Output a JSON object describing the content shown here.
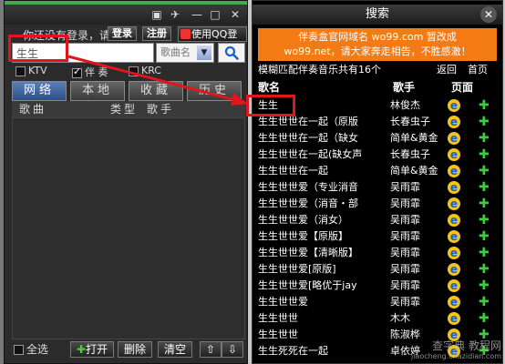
{
  "left_window": {
    "title_buttons": {
      "skin": "▣",
      "pin": "✈",
      "min": "—",
      "max": "□",
      "close": "✕"
    },
    "status_text": "你还没有登录，请",
    "login_label": "登录",
    "register_label": "注册",
    "qq_label": "使用QQ登录",
    "search": {
      "value": "生生",
      "category": "歌曲名",
      "button_icon": "search-icon"
    },
    "checkboxes": [
      {
        "label": "KTV",
        "checked": false
      },
      {
        "label": "伴 奏",
        "checked": true
      },
      {
        "label": "KRC",
        "checked": false
      }
    ],
    "tabs": [
      "网络",
      "本地",
      "收藏",
      "历史"
    ],
    "active_tab": 0,
    "columns": {
      "song": "歌曲",
      "type": "类型",
      "singer": "歌手"
    },
    "bottom": {
      "select_all": "全选",
      "play": "打开",
      "delete": "删除",
      "clear": "清空",
      "up": "⇧",
      "down": "⇩"
    }
  },
  "right_window": {
    "title": "搜索",
    "close_label": "✕",
    "banner_line1": "伴奏盒官网域名 ",
    "banner_url1": "wo99.com",
    "banner_line1_end": " 暂改成",
    "banner_url2": "wo99.net",
    "banner_line2_end": "，请大家奔走相告，不胜感激！",
    "info": "模糊匹配伴奏音乐共有16个",
    "back_label": "返回",
    "home_label": "首页",
    "headers": {
      "song": "歌名",
      "singer": "歌手",
      "page": "页面"
    },
    "rows": [
      {
        "song": "生生",
        "singer": "林俊杰"
      },
      {
        "song": "生生世世在一起（原版",
        "singer": "长春虫子"
      },
      {
        "song": "生生世世在一起（缺女",
        "singer": "简单&黄金"
      },
      {
        "song": "生生世世在一起(缺女声",
        "singer": "长春虫子"
      },
      {
        "song": "生生世世在一起",
        "singer": "简单&黄金"
      },
      {
        "song": "生生世世爱（专业消音",
        "singer": "吴雨霏"
      },
      {
        "song": "生生世世爱（消音・部",
        "singer": "吴雨霏"
      },
      {
        "song": "生生世世爱（消女）",
        "singer": "吴雨霏"
      },
      {
        "song": "生生世世爱【原版】",
        "singer": "吴雨霏"
      },
      {
        "song": "生生世世爱【清晰版】",
        "singer": "吴雨霏"
      },
      {
        "song": "生生世世爱[原版]",
        "singer": "吴雨霏"
      },
      {
        "song": "生生世世爱[略优于jay",
        "singer": "吴雨霏"
      },
      {
        "song": "生生世世爱",
        "singer": "吴雨霏"
      },
      {
        "song": "生生世世",
        "singer": "木木"
      },
      {
        "song": "生生世世",
        "singer": "陈淑桦"
      },
      {
        "song": "生生死死在一起",
        "singer": "卓依婷"
      }
    ]
  },
  "watermark": {
    "line1": "查字典 教程网",
    "line2": "jiaocheng.chazidian.com"
  },
  "colors": {
    "accent_red": "#e0161c",
    "banner_orange": "#f47a15",
    "tab_blue": "#3b64a2",
    "add_green": "#36d23a"
  }
}
